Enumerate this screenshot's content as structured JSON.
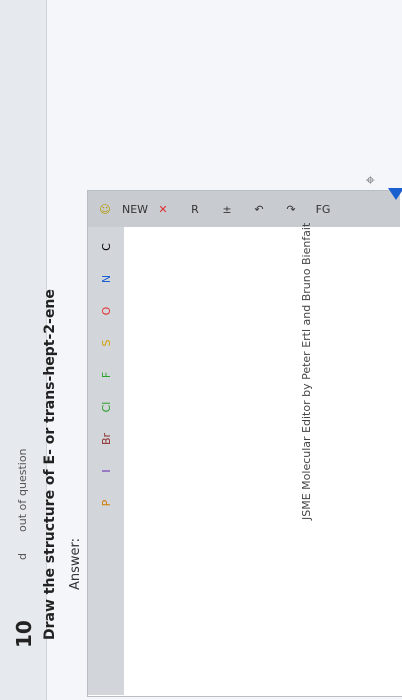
{
  "question": {
    "number": "10",
    "side_d": "d",
    "side_out": "out of",
    "side_question": "question",
    "prompt": "Draw the structure of E- or trans-hept-2-ene"
  },
  "answer": {
    "label": "Answer:"
  },
  "editor": {
    "credit": "JSME Molecular Editor by Peter Ertl and Bruno Bienfait",
    "tools": [
      "☺",
      "□",
      "NEW",
      "✕",
      "R",
      "±",
      "↶",
      "↷",
      "FG"
    ],
    "elements": [
      "C",
      "N",
      "O",
      "S",
      "F",
      "Cl",
      "Br",
      "I",
      "P"
    ],
    "colors": {
      "toolbar": "#c8cbd0",
      "panel": "#d2d5da",
      "accent": "#1a5fd0",
      "error": "#e03030",
      "smile": "#f2d21a"
    }
  }
}
